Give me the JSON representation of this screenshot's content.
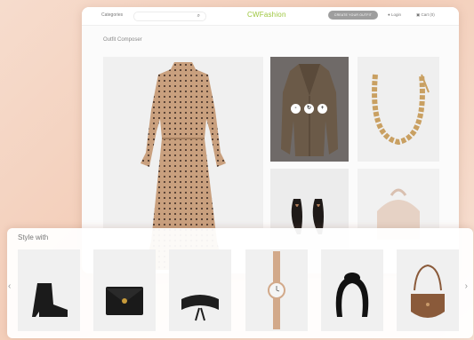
{
  "header": {
    "categories_label": "Categories",
    "search_placeholder": "",
    "logo_text": "CWFashion",
    "cta_label": "CREATE YOUR OUTFIT",
    "login_label": "Login",
    "cart_label": "Cart (0)"
  },
  "main": {
    "page_title": "Outfit Composer"
  },
  "composer": {
    "overlay_buttons": [
      "-",
      "↻",
      "+"
    ]
  },
  "style_with": {
    "title": "Style with",
    "items": [
      {
        "name": "ankle-boot"
      },
      {
        "name": "clutch-bag"
      },
      {
        "name": "waist-belt"
      },
      {
        "name": "watch"
      },
      {
        "name": "headband"
      },
      {
        "name": "saddle-bag"
      }
    ]
  },
  "colors": {
    "logo_green": "#9cc63c",
    "blazer_brown": "#6b5a48",
    "dress_tan": "#c9a07e",
    "gold": "#c9a062"
  }
}
